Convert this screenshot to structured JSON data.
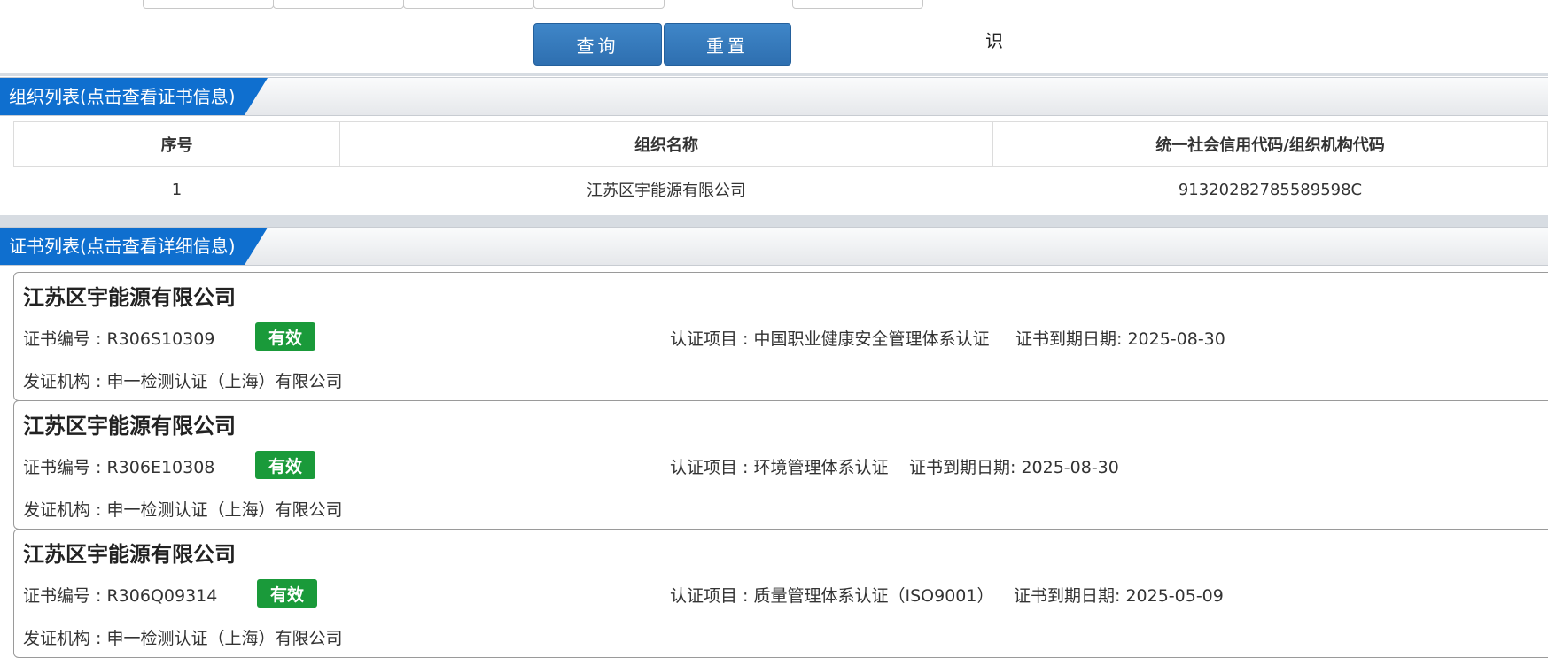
{
  "form": {
    "query_button": "查询",
    "reset_button": "重置",
    "stray_text": "识"
  },
  "org_section": {
    "title": "组织列表(点击查看证书信息)",
    "columns": [
      "序号",
      "组织名称",
      "统一社会信用代码/组织机构代码"
    ],
    "rows": [
      {
        "index": "1",
        "name": "江苏区宇能源有限公司",
        "code": "91320282785589598C"
      }
    ]
  },
  "cert_section": {
    "title": "证书列表(点击查看详细信息)",
    "certs": [
      {
        "company": "江苏区宇能源有限公司",
        "cert_no": "证书编号 : R306S10309",
        "status": "有效",
        "project": "认证项目 : 中国职业健康安全管理体系认证",
        "expiry": "证书到期日期: 2025-08-30",
        "issuer": "发证机构 : 申一检测认证（上海）有限公司"
      },
      {
        "company": "江苏区宇能源有限公司",
        "cert_no": "证书编号 : R306E10308",
        "status": "有效",
        "project": "认证项目 : 环境管理体系认证",
        "expiry": "证书到期日期: 2025-08-30",
        "issuer": "发证机构 : 申一检测认证（上海）有限公司"
      },
      {
        "company": "江苏区宇能源有限公司",
        "cert_no": "证书编号 : R306Q09314",
        "status": "有效",
        "project": "认证项目 : 质量管理体系认证（ISO9001）",
        "expiry": "证书到期日期: 2025-05-09",
        "issuer": "发证机构 : 申一检测认证（上海）有限公司"
      }
    ]
  },
  "colors": {
    "accent": "#0f6fcf",
    "button": "#3579b9",
    "status_valid": "#1a9a3a"
  }
}
